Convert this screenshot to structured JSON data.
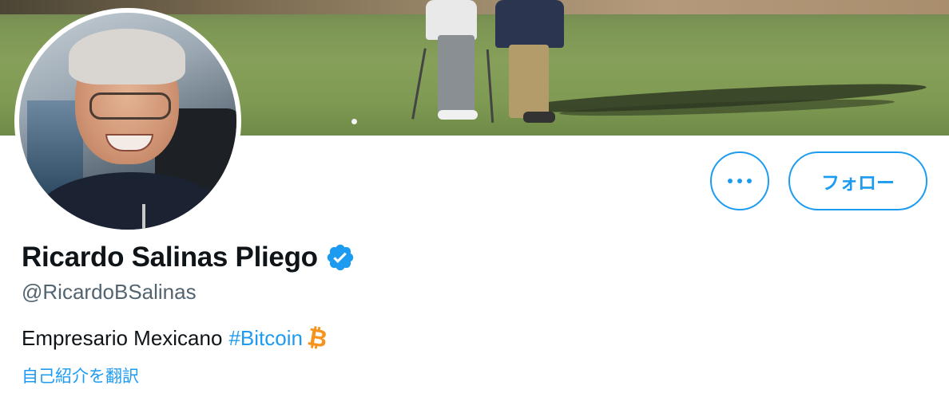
{
  "profile": {
    "name": "Ricardo Salinas Pliego",
    "handle": "@RicardoBSalinas",
    "bio_text": "Empresario Mexicano",
    "bio_hashtag": "#Bitcoin",
    "bio_emoji": "₿",
    "translate_link": "自己紹介を翻訳",
    "verified": true
  },
  "actions": {
    "follow_label": "フォロー",
    "more_icon": "more-horizontal-icon"
  },
  "colors": {
    "accent": "#1d9bf0",
    "text_primary": "#0f1419",
    "text_secondary": "#536471",
    "bitcoin": "#f7931a"
  }
}
